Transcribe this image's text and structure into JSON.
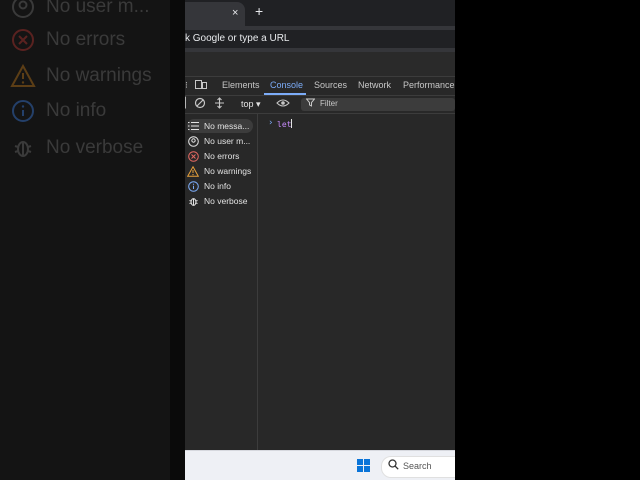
{
  "browser": {
    "tab_close": "×",
    "new_tab": "+",
    "omnibox_text": "k Google or type a URL"
  },
  "devtools": {
    "tabs": [
      "Elements",
      "Console",
      "Sources",
      "Network",
      "Performance"
    ],
    "active_tab": "Console",
    "context": "top ▾",
    "filter_placeholder": "Filter",
    "sidebar": [
      {
        "label": "No messa...",
        "icon": "list-icon"
      },
      {
        "label": "No user m...",
        "icon": "user-icon"
      },
      {
        "label": "No errors",
        "icon": "error-icon"
      },
      {
        "label": "No warnings",
        "icon": "warning-icon"
      },
      {
        "label": "No info",
        "icon": "info-icon"
      },
      {
        "label": "No verbose",
        "icon": "bug-icon"
      }
    ],
    "console_prompt": "›",
    "console_input": "let"
  },
  "zoomed_backdrop": {
    "items": [
      "No user m...",
      "No errors",
      "No warnings",
      "No info",
      "No verbose"
    ]
  },
  "taskbar": {
    "search_label": "Search"
  },
  "colors": {
    "accent": "#7cacf8",
    "error": "#e46962",
    "warning": "#e9a23b",
    "info": "#7cacf8"
  }
}
